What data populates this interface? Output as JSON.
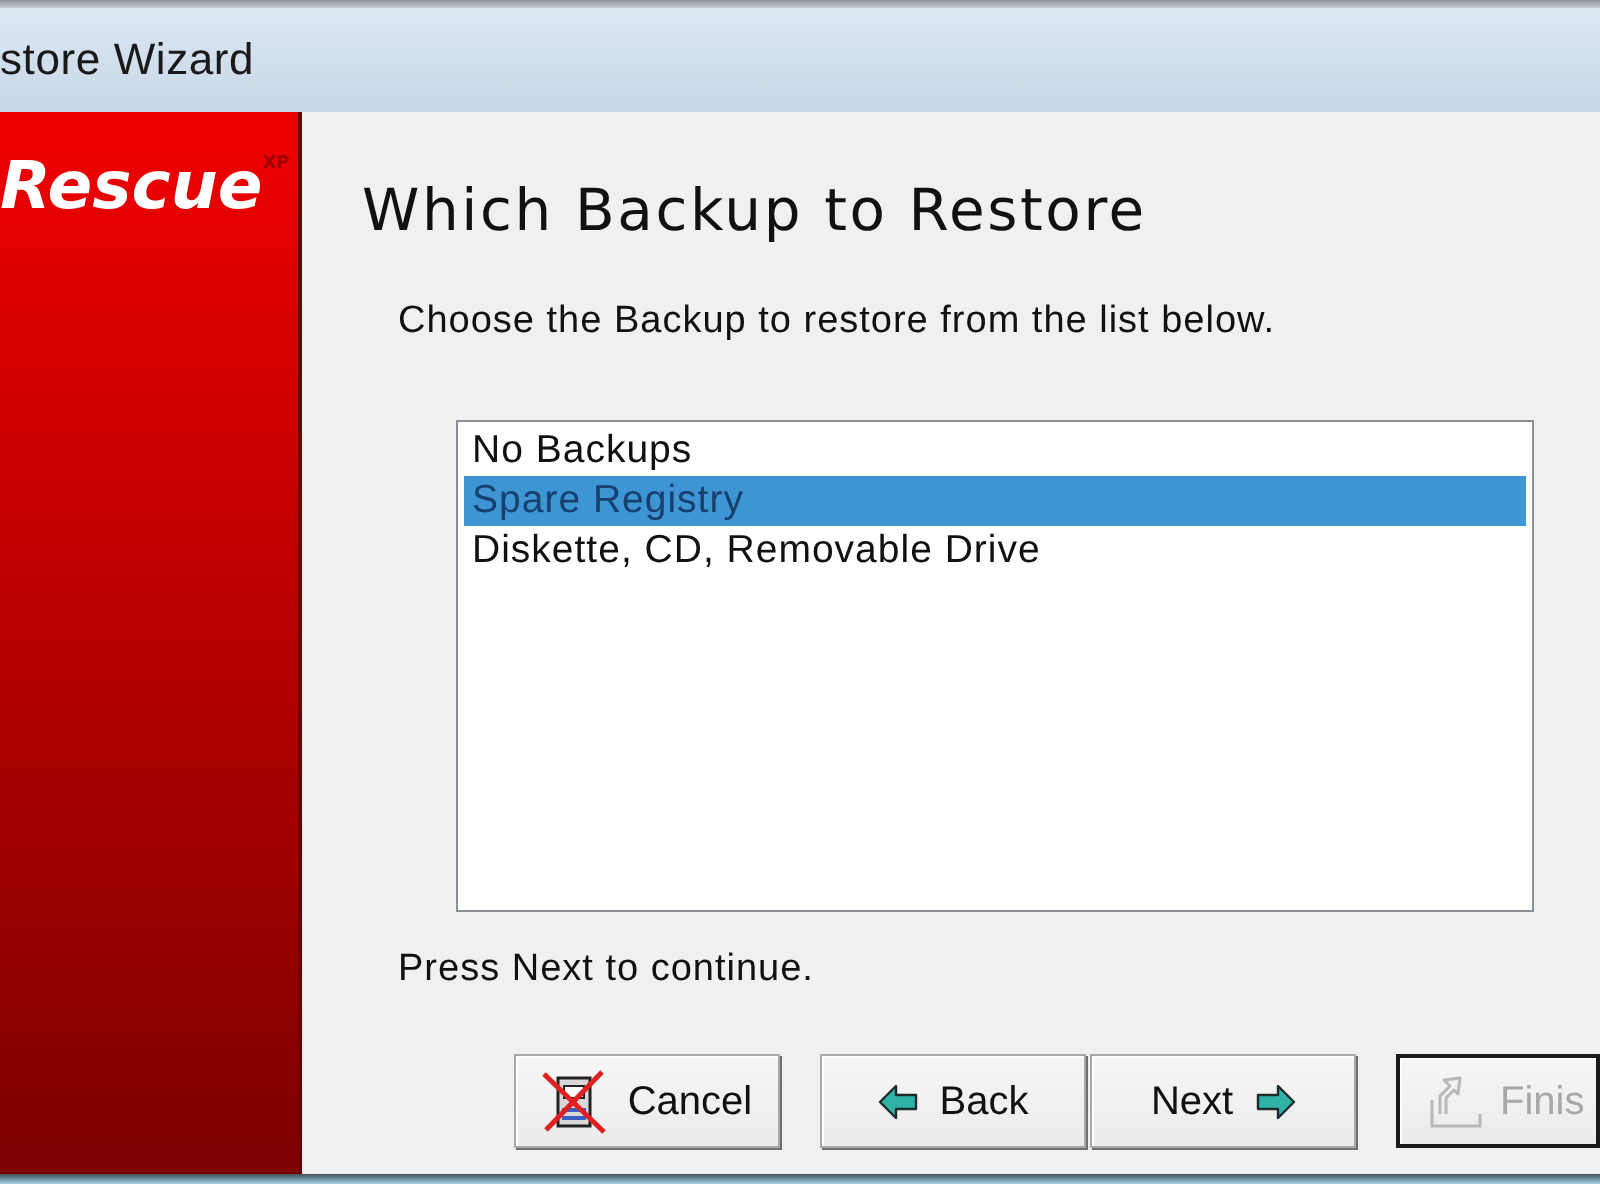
{
  "window": {
    "title": "store Wizard"
  },
  "sidebar": {
    "logo": "Rescue",
    "logo_superscript": "XP"
  },
  "page": {
    "heading": "Which Backup to Restore",
    "instruction": "Choose the Backup to restore from the list below.",
    "backups": [
      {
        "label": "No Backups",
        "selected": false
      },
      {
        "label": "Spare Registry",
        "selected": true
      },
      {
        "label": "Diskette, CD, Removable Drive",
        "selected": false
      }
    ],
    "hint": "Press Next to continue."
  },
  "buttons": [
    {
      "kind": "cancel",
      "label": "Cancel",
      "disabled": false,
      "default": false
    },
    {
      "kind": "back",
      "label": "Back",
      "disabled": false,
      "default": false
    },
    {
      "kind": "next",
      "label": "Next",
      "disabled": false,
      "default": false
    },
    {
      "kind": "finish",
      "label": "Finis",
      "disabled": true,
      "default": true
    }
  ]
}
